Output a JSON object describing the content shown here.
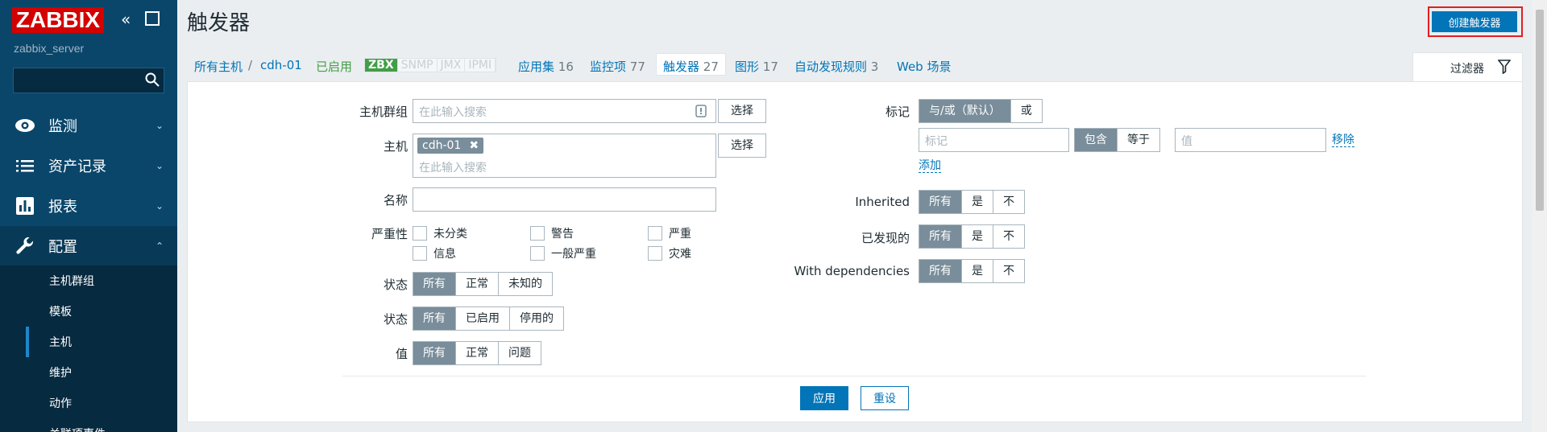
{
  "sidebar": {
    "logo": "ZABBIX",
    "collapse_glyph": "«",
    "server_name": "zabbix_server",
    "menu": [
      {
        "label": "监测",
        "icon": "eye-icon",
        "chevron": "⌄"
      },
      {
        "label": "资产记录",
        "icon": "list-icon",
        "chevron": "⌄"
      },
      {
        "label": "报表",
        "icon": "bar-chart-icon",
        "chevron": "⌄"
      },
      {
        "label": "配置",
        "icon": "wrench-icon",
        "chevron": "⌃"
      }
    ],
    "submenu": [
      {
        "label": "主机群组"
      },
      {
        "label": "模板"
      },
      {
        "label": "主机",
        "active": true
      },
      {
        "label": "维护"
      },
      {
        "label": "动作"
      },
      {
        "label": "关联项事件"
      }
    ]
  },
  "header": {
    "title": "触发器",
    "create_button": "创建触发器"
  },
  "nav": {
    "all_hosts": "所有主机",
    "separator": "/",
    "host": "cdh-01",
    "status": "已启用",
    "availability": [
      "ZBX",
      "SNMP",
      "JMX",
      "IPMI"
    ],
    "items": [
      {
        "label": "应用集",
        "count": "16"
      },
      {
        "label": "监控项",
        "count": "77"
      },
      {
        "label": "触发器",
        "count": "27"
      },
      {
        "label": "图形",
        "count": "17"
      },
      {
        "label": "自动发现规则",
        "count": "3"
      },
      {
        "label": "Web 场景",
        "count": ""
      }
    ],
    "filter_tab": "过滤器"
  },
  "filter": {
    "host_group_label": "主机群组",
    "host_group_placeholder": "在此输入搜索",
    "select_button": "选择",
    "host_label": "主机",
    "host_tag": "cdh-01",
    "host_placeholder": "在此输入搜索",
    "name_label": "名称",
    "name_value": "",
    "severity_label": "严重性",
    "severities": [
      "未分类",
      "警告",
      "严重",
      "信息",
      "一般严重",
      "灾难"
    ],
    "state_label": "状态",
    "state_options": [
      "所有",
      "正常",
      "未知的"
    ],
    "status_label": "状态",
    "status_options": [
      "所有",
      "已启用",
      "停用的"
    ],
    "value_label": "值",
    "value_options": [
      "所有",
      "正常",
      "问题"
    ],
    "tags_label": "标记",
    "tags_op_options": [
      "与/或（默认）",
      "或"
    ],
    "tag_placeholder": "标记",
    "tag_match_options": [
      "包含",
      "等于"
    ],
    "tag_value_placeholder": "值",
    "remove_link": "移除",
    "add_link": "添加",
    "inherited_label": "Inherited",
    "discovered_label": "已发现的",
    "dependencies_label": "With dependencies",
    "tri_options": [
      "所有",
      "是",
      "不"
    ],
    "apply_button": "应用",
    "reset_button": "重设"
  }
}
